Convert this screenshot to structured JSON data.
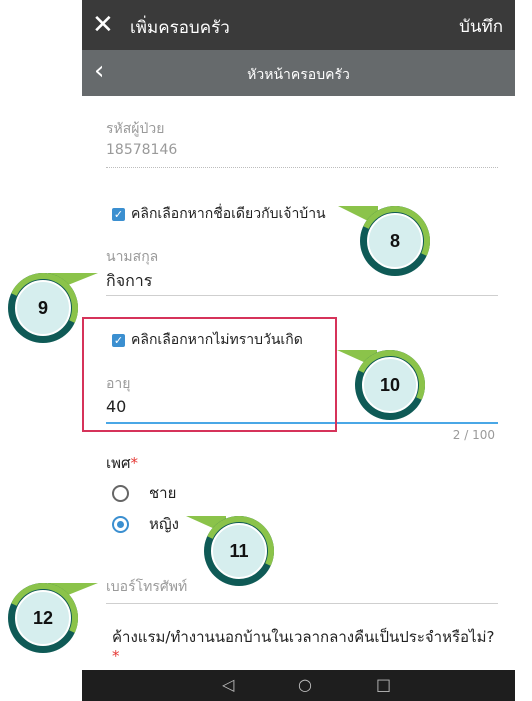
{
  "app_bar": {
    "title": "เพิ่มครอบครัว",
    "save_label": "บันทึก"
  },
  "sub_bar": {
    "title": "หัวหน้าครอบครัว"
  },
  "form": {
    "patient_id": {
      "label": "รหัสผู้ป่วย",
      "value": "18578146"
    },
    "same_name_checkbox": {
      "label": "คลิกเลือกหากชื่อเดียวกับเจ้าบ้าน",
      "checked": true
    },
    "surname": {
      "label": "นามสกุล",
      "value": "กิจการ"
    },
    "unknown_birthdate_checkbox": {
      "label": "คลิกเลือกหากไม่ทราบวันเกิด",
      "checked": true
    },
    "age": {
      "label": "อายุ",
      "value": "40",
      "counter": "2 / 100"
    },
    "sex": {
      "label": "เพศ",
      "required_mark": "*",
      "options": [
        "ชาย",
        "หญิง"
      ],
      "selected": "หญิง"
    },
    "phone": {
      "label": "เบอร์โทรศัพท์"
    },
    "overnight_question": {
      "label": "ค้างแรม/ทำงานนอกบ้านในเวลากลางคืนเป็นประจำหรือไม่?",
      "required_mark": "*"
    }
  },
  "callouts": [
    "8",
    "9",
    "10",
    "11",
    "12"
  ],
  "colors": {
    "app_bar": "#3a3a3a",
    "sub_bar": "#666a6c",
    "accent": "#3b8fd0",
    "highlight_border": "#d6335a",
    "callout_ring": "#0f5a56",
    "callout_arc": "#8bc34a",
    "callout_fill": "#d6eeee"
  },
  "icons": {
    "close": "close-icon",
    "back": "back-arrow-icon",
    "checkbox": "check-icon",
    "nav_back": "triangle-back-icon",
    "nav_home": "circle-home-icon",
    "nav_recent": "square-recent-icon"
  }
}
